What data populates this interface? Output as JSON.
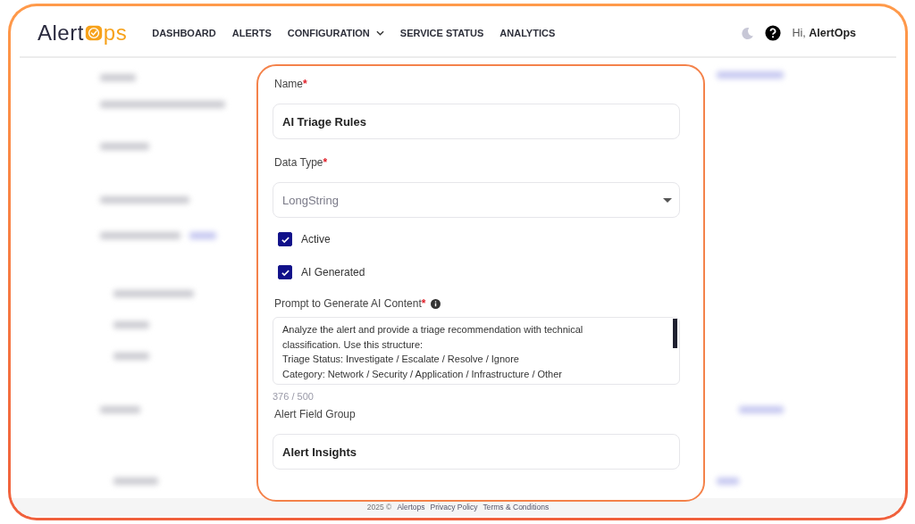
{
  "header": {
    "logo": {
      "before": "Alert",
      "after": "ps"
    },
    "nav": [
      {
        "label": "DASHBOARD",
        "has_dropdown": false
      },
      {
        "label": "ALERTS",
        "has_dropdown": false
      },
      {
        "label": "CONFIGURATION",
        "has_dropdown": true
      },
      {
        "label": "SERVICE STATUS",
        "has_dropdown": false
      },
      {
        "label": "ANALYTICS",
        "has_dropdown": false
      }
    ],
    "greeting": "Hi, **AlertOps**"
  },
  "form": {
    "fields": [
      {
        "kind": "text",
        "label": "Name",
        "required_mark": "*",
        "value": "AI Triage Rules"
      },
      {
        "kind": "select",
        "label": "Data Type",
        "required_mark": "*",
        "value": "LongString"
      },
      {
        "kind": "checkbox",
        "label": "Active",
        "checked": true
      },
      {
        "kind": "checkbox",
        "label": "AI Generated",
        "checked": true
      },
      {
        "kind": "textarea",
        "label": "Prompt to Generate AI Content",
        "required_mark": "*",
        "info": true,
        "lines": [
          "Analyze the alert and provide a triage recommendation with technical classification. Use this structure:",
          "Triage Status: Investigate / Escalate / Resolve / Ignore",
          "Category: Network / Security / Application / Infrastructure / Other"
        ],
        "counter": "376 / 500"
      },
      {
        "kind": "text",
        "label": "Alert Field Group",
        "value": "Alert Insights"
      }
    ]
  },
  "footer": {
    "copyright": "2025 ©",
    "links": [
      "Alertops",
      "Privacy Policy",
      "Terms & Conditions"
    ]
  }
}
